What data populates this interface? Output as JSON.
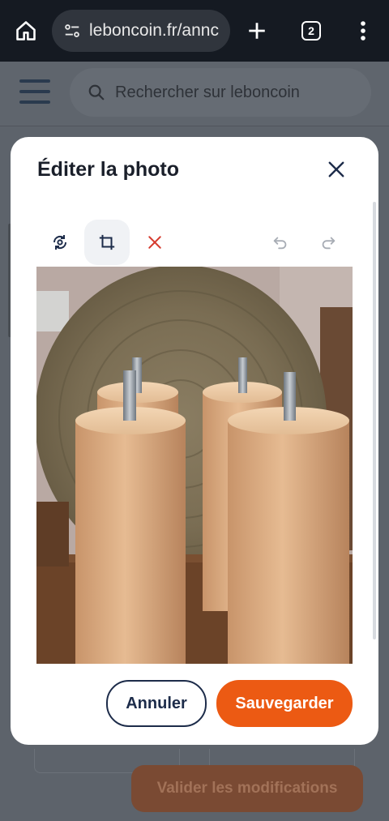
{
  "browser": {
    "url": "leboncoin.fr/annc",
    "tab_count": "2"
  },
  "page": {
    "search_placeholder": "Rechercher sur leboncoin",
    "validate_label": "Valider les modifications"
  },
  "modal": {
    "title": "Éditer la photo",
    "cancel_label": "Annuler",
    "save_label": "Sauvegarder",
    "tools": [
      "rotate-icon",
      "crop-icon",
      "delete-icon",
      "undo-icon",
      "redo-icon"
    ],
    "active_tool": "crop-icon"
  },
  "colors": {
    "accent": "#ec5a13",
    "navy": "#1d2c4a",
    "delete": "#d63b2f"
  }
}
